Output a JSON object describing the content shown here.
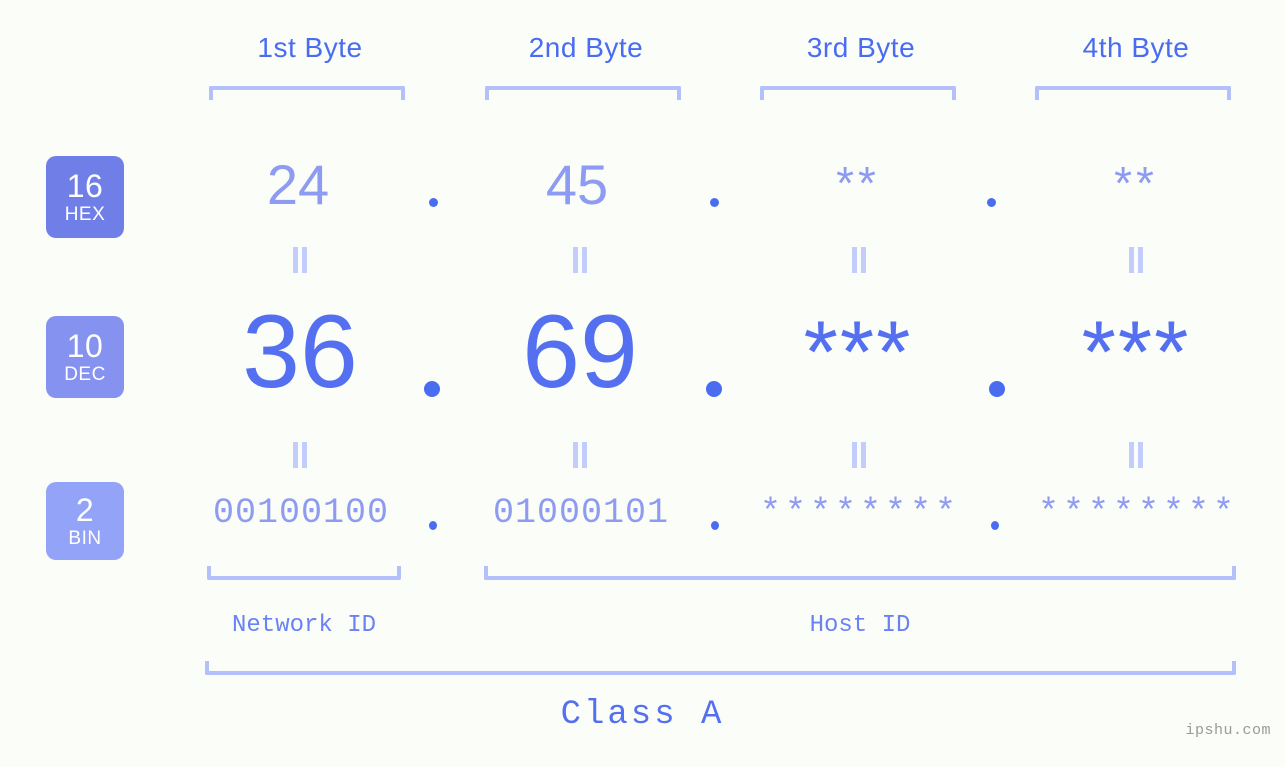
{
  "meta": {
    "background": "#fbfdf8",
    "accent_dark": "#4a6cf0",
    "accent_mid": "#8e9bf2",
    "accent_light": "#b3c0fa",
    "watermark": "ipshu.com"
  },
  "byte_headers": [
    {
      "label": "1st Byte"
    },
    {
      "label": "2nd Byte"
    },
    {
      "label": "3rd Byte"
    },
    {
      "label": "4th Byte"
    }
  ],
  "bases": [
    {
      "num": "16",
      "name": "HEX",
      "color": "#707fe8"
    },
    {
      "num": "10",
      "name": "DEC",
      "color": "#8592f0"
    },
    {
      "num": "2",
      "name": "BIN",
      "color": "#93a3f7"
    }
  ],
  "rows": {
    "hex": {
      "values": [
        "24",
        "45",
        "**",
        "**"
      ],
      "separator": "."
    },
    "dec": {
      "values": [
        "36",
        "69",
        "***",
        "***"
      ],
      "separator": "."
    },
    "bin": {
      "values": [
        "00100100",
        "01000101",
        "********",
        "********"
      ],
      "separator": "."
    }
  },
  "equals_symbol": "=",
  "segments": {
    "network_id": "Network ID",
    "host_id": "Host ID"
  },
  "class_label": "Class A"
}
